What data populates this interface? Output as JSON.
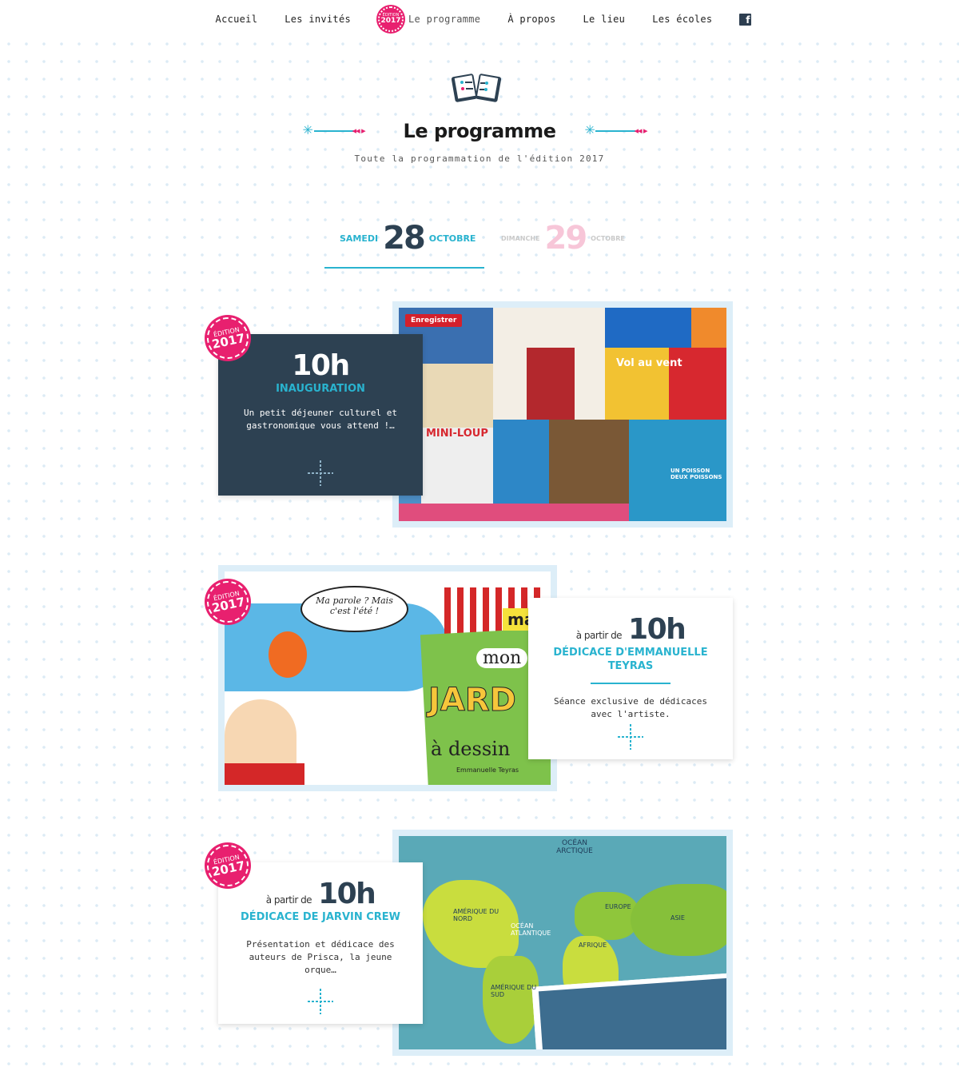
{
  "nav": {
    "items": [
      {
        "label": "Accueil"
      },
      {
        "label": "Les invités"
      },
      {
        "label": "Le programme"
      },
      {
        "label": "À propos"
      },
      {
        "label": "Le lieu"
      },
      {
        "label": "Les écoles"
      }
    ],
    "badge_edition": "ÉDITION",
    "badge_year": "2017"
  },
  "header": {
    "title": "Le programme",
    "subtitle": "Toute la programmation de l'édition 2017"
  },
  "dates": [
    {
      "weekday": "SAMEDI",
      "day": "28",
      "month": "OCTOBRE",
      "active": true
    },
    {
      "weekday": "DIMANCHE",
      "day": "29",
      "month": "OCTOBRE",
      "active": false
    }
  ],
  "events": [
    {
      "badge_edition": "ÉDITION",
      "badge_year": "2017",
      "from": "",
      "hour": "10h",
      "title": "INAUGURATION",
      "description": "Un petit déjeuner culturel et gastronomique vous attend !…",
      "pin_label": "Enregistrer"
    },
    {
      "badge_edition": "ÉDITION",
      "badge_year": "2017",
      "from": "à partir de",
      "hour": "10h",
      "title": "DÉDICACE D'EMMANUELLE TEYRAS",
      "description": "Séance exclusive de dédicaces avec l'artiste."
    },
    {
      "badge_edition": "ÉDITION",
      "badge_year": "2017",
      "from": "à partir de",
      "hour": "10h",
      "title": "DÉDICACE DE JARVIN CREW",
      "description": "Présentation et dédicace des auteurs de Prisca, la jeune orque…"
    }
  ],
  "images": {
    "collage_titles": [
      "Vol au vent",
      "MINI-LOUP",
      "UN POISSON DEUX POISSONS"
    ],
    "teyras_bubble": "Ma parole ? Mais c'est l'été !",
    "teyras_book": [
      "ma",
      "mon",
      "JARD",
      "à dessin",
      "Emmanuelle Teyras"
    ],
    "map_labels": [
      "OCÉAN ARCTIQUE",
      "AMÉRIQUE DU NORD",
      "EUROPE",
      "ASIE",
      "OCÉAN ATLANTIQUE",
      "AFRIQUE",
      "AMÉRIQUE DU SUD"
    ]
  },
  "colors": {
    "accent_blue": "#29b3cf",
    "accent_pink": "#e8206f",
    "dark_navy": "#2d4152"
  }
}
